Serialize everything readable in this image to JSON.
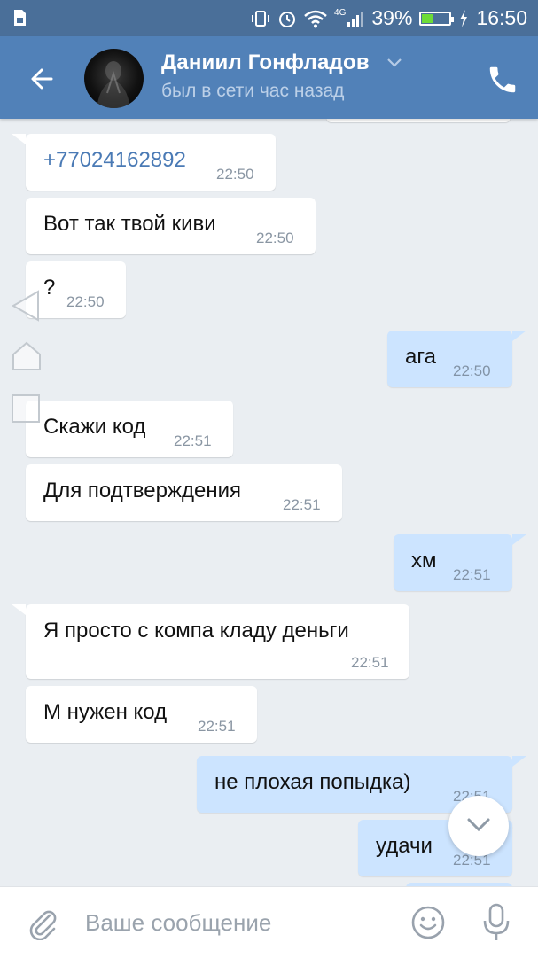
{
  "status_bar": {
    "battery_percent": "39%",
    "battery_level": 0.39,
    "time": "16:50",
    "network": "4G",
    "icons": [
      "sim-icon",
      "vibrate-icon",
      "alarm-icon",
      "wifi-icon",
      "signal-icon",
      "battery-icon",
      "charging-icon"
    ]
  },
  "header": {
    "name": "Даниил Гонфладов",
    "status": "был в сети час назад",
    "icons": [
      "back-arrow-icon",
      "chevron-down-icon",
      "phone-icon"
    ]
  },
  "messages": [
    {
      "direction": "in",
      "text": "+77024162892",
      "time": "22:50",
      "is_link": true
    },
    {
      "direction": "in",
      "text": "Вот так твой киви",
      "time": "22:50"
    },
    {
      "direction": "in",
      "text": "?",
      "time": "22:50"
    },
    {
      "direction": "out",
      "text": "ага",
      "time": "22:50"
    },
    {
      "direction": "in",
      "text": "Скажи код",
      "time": "22:51"
    },
    {
      "direction": "in",
      "text": "Для подтверждения",
      "time": "22:51"
    },
    {
      "direction": "out",
      "text": "хм",
      "time": "22:51"
    },
    {
      "direction": "in",
      "text": "Я просто с компа кладу деньги",
      "time": "22:51"
    },
    {
      "direction": "in",
      "text": "М нужен код",
      "time": "22:51"
    },
    {
      "direction": "out",
      "text": "не плохая попыдка)",
      "time": "22:51"
    },
    {
      "direction": "out",
      "text": "удачи",
      "time": "22:51"
    }
  ],
  "composer": {
    "placeholder": "Ваше сообщение",
    "icons": [
      "paperclip-icon",
      "emoji-icon",
      "microphone-icon"
    ]
  },
  "colors": {
    "header": "#5181b8",
    "status_bar": "#4a6f99",
    "background": "#eaeef2",
    "incoming_bubble": "#ffffff",
    "outgoing_bubble": "#cce4ff",
    "link": "#4a7ab5"
  }
}
